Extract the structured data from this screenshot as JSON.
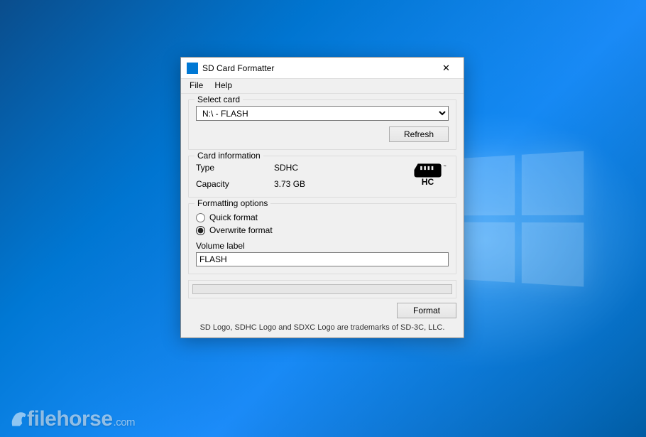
{
  "window": {
    "title": "SD Card Formatter",
    "close_glyph": "✕"
  },
  "menubar": {
    "file": "File",
    "help": "Help"
  },
  "select_card": {
    "group_label": "Select card",
    "selected": "N:\\ - FLASH",
    "refresh_label": "Refresh"
  },
  "card_info": {
    "group_label": "Card information",
    "type_label": "Type",
    "type_value": "SDHC",
    "capacity_label": "Capacity",
    "capacity_value": "3.73 GB"
  },
  "formatting": {
    "group_label": "Formatting options",
    "quick_label": "Quick format",
    "overwrite_label": "Overwrite format",
    "selected_option": "overwrite",
    "volume_label_caption": "Volume label",
    "volume_label_value": "FLASH"
  },
  "format_button": "Format",
  "trademark_text": "SD Logo, SDHC Logo and SDXC Logo are trademarks of SD-3C, LLC.",
  "watermark": {
    "text": "filehorse",
    "suffix": ".com"
  }
}
